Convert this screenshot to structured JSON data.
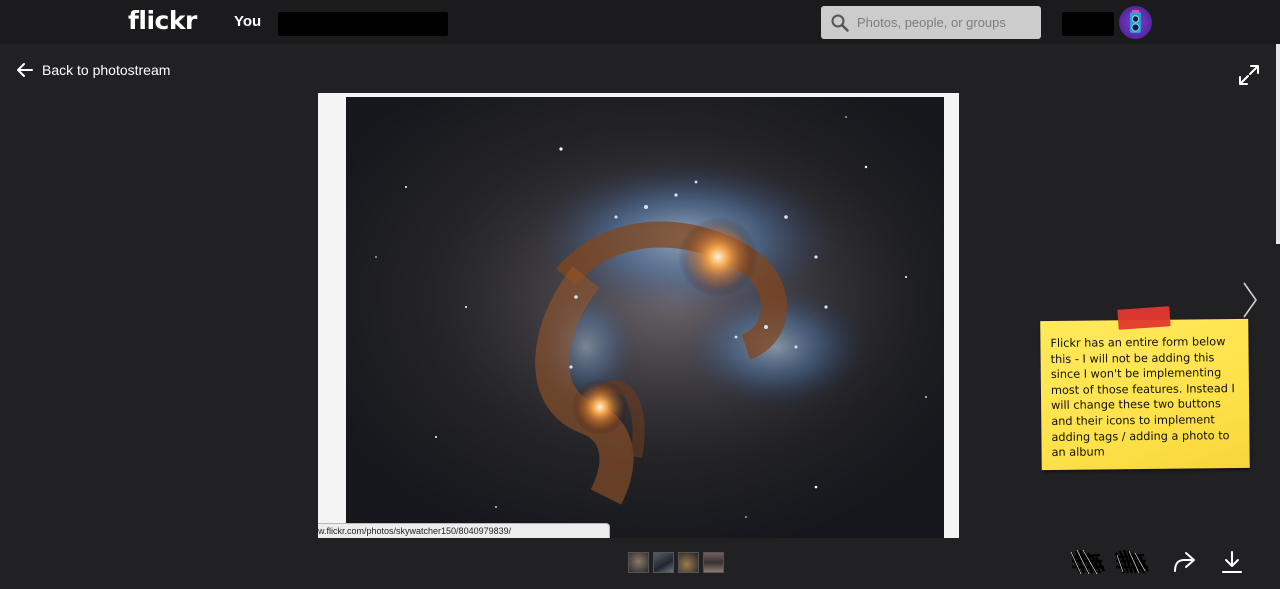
{
  "header": {
    "logo": "flickr",
    "nav_you": "You",
    "search_placeholder": "Photos, people, or groups"
  },
  "viewer": {
    "back_label": "Back to photostream",
    "status_url": "w.flickr.com/photos/skywatcher150/8040979839/"
  },
  "filmstrip": {
    "thumbnails": [
      {
        "color": "#4a4540"
      },
      {
        "color": "#3a4048"
      },
      {
        "color": "#504538"
      },
      {
        "color": "#5a4a45"
      }
    ]
  },
  "sticky_note": {
    "text": "Flickr has an entire form below this -  I will not be adding this since I won't be implementing most of those features. Instead I will change these two buttons and their icons to implement adding tags / adding a photo to an album"
  },
  "colors": {
    "background": "#212124",
    "topbar": "#1b1b1d",
    "sticky": "#fde24a",
    "tape": "#e3382f",
    "avatar": "#8a3bd1"
  },
  "icons": [
    "search-icon",
    "back-arrow-icon",
    "expand-icon",
    "chevron-right-icon",
    "share-icon",
    "download-icon"
  ]
}
